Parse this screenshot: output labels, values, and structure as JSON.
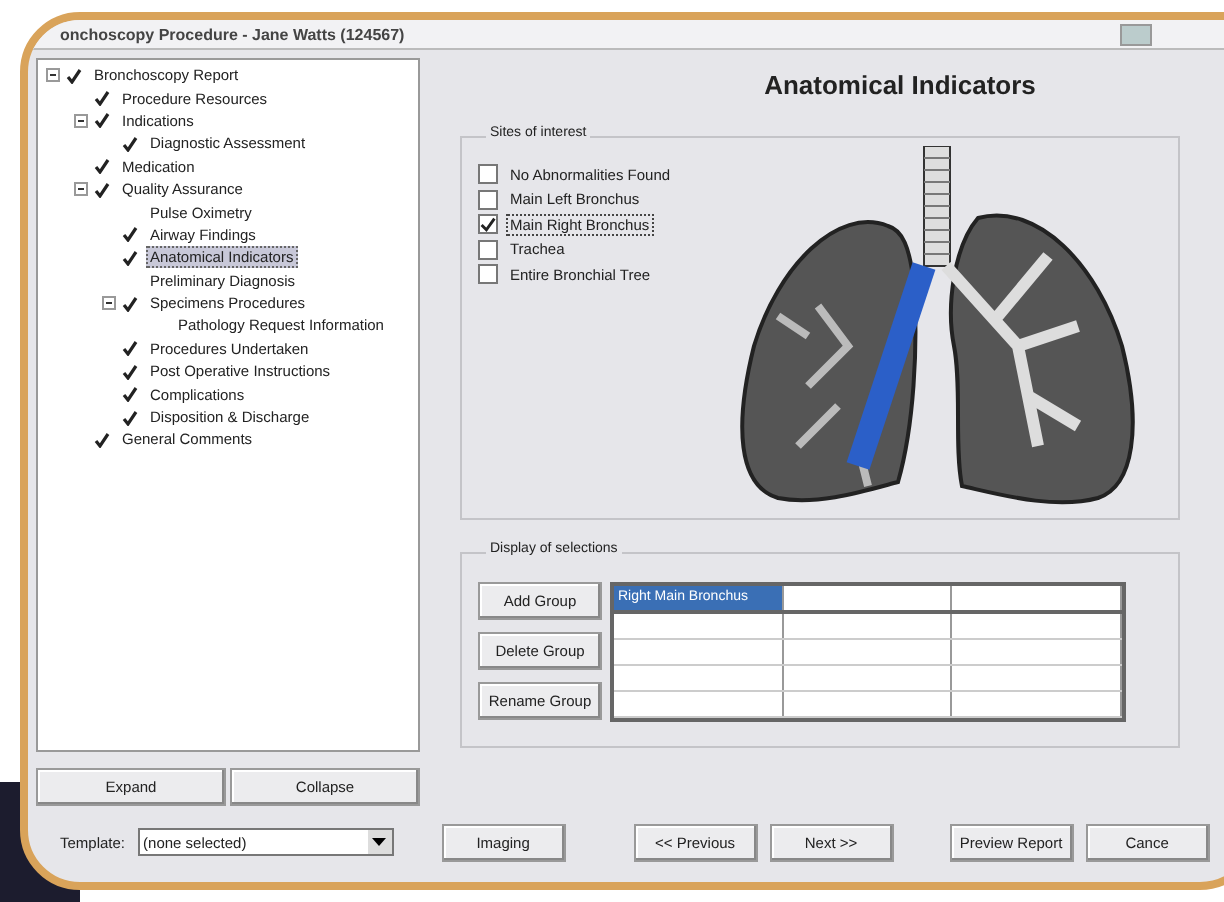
{
  "window": {
    "title": "onchoscopy Procedure - Jane Watts (124567)"
  },
  "tree": [
    {
      "label": "Bronchoscopy Report",
      "checked": true,
      "selected": false,
      "expanded": true,
      "children": [
        {
          "label": "Procedure Resources",
          "checked": true,
          "selected": false
        },
        {
          "label": "Indications",
          "checked": true,
          "selected": false,
          "expanded": true,
          "children": [
            {
              "label": "Diagnostic Assessment",
              "checked": true,
              "selected": false
            }
          ]
        },
        {
          "label": "Medication",
          "checked": true,
          "selected": false
        },
        {
          "label": "Quality Assurance",
          "checked": true,
          "selected": false,
          "expanded": true,
          "children": [
            {
              "label": "Pulse Oximetry",
              "checked": false,
              "selected": false
            },
            {
              "label": "Airway Findings",
              "checked": true,
              "selected": false
            },
            {
              "label": "Anatomical Indicators",
              "checked": true,
              "selected": true
            },
            {
              "label": "Preliminary Diagnosis",
              "checked": false,
              "selected": false
            },
            {
              "label": "Specimens Procedures",
              "checked": true,
              "selected": false,
              "expanded": true,
              "children": [
                {
                  "label": "Pathology Request Information",
                  "checked": false,
                  "selected": false
                }
              ]
            },
            {
              "label": "Procedures Undertaken",
              "checked": true,
              "selected": false
            },
            {
              "label": "Post Operative Instructions",
              "checked": true,
              "selected": false
            },
            {
              "label": "Complications",
              "checked": true,
              "selected": false
            },
            {
              "label": "Disposition & Discharge",
              "checked": true,
              "selected": false
            }
          ]
        },
        {
          "label": "General Comments",
          "checked": true,
          "selected": false
        }
      ]
    }
  ],
  "tree_buttons": [
    "Expand",
    "Collapse"
  ],
  "heading": "Anatomical Indicators",
  "sites": {
    "title": "Sites of interest",
    "options": [
      {
        "label": "No Abnormalities Found",
        "checked": false,
        "focused": false
      },
      {
        "label": "Main Left Bronchus",
        "checked": false,
        "focused": false
      },
      {
        "label": "Main Right Bronchus",
        "checked": true,
        "focused": true
      },
      {
        "label": "Trachea",
        "checked": false,
        "focused": false
      },
      {
        "label": "Entire Bronchial Tree",
        "checked": false,
        "focused": false
      }
    ]
  },
  "selections": {
    "title": "Display of selections",
    "buttons": [
      "Add Group",
      "Delete Group",
      "Rename Group"
    ],
    "rows": [
      [
        {
          "text": "Right Main Bronchus",
          "selected": true
        },
        {
          "text": "",
          "selected": false
        },
        {
          "text": "",
          "selected": false
        }
      ]
    ]
  },
  "template": {
    "label": "Template:",
    "value": "(none selected)"
  },
  "footer_buttons": [
    "Imaging",
    "<< Previous",
    "Next >>",
    "Preview Report",
    "Cance"
  ]
}
